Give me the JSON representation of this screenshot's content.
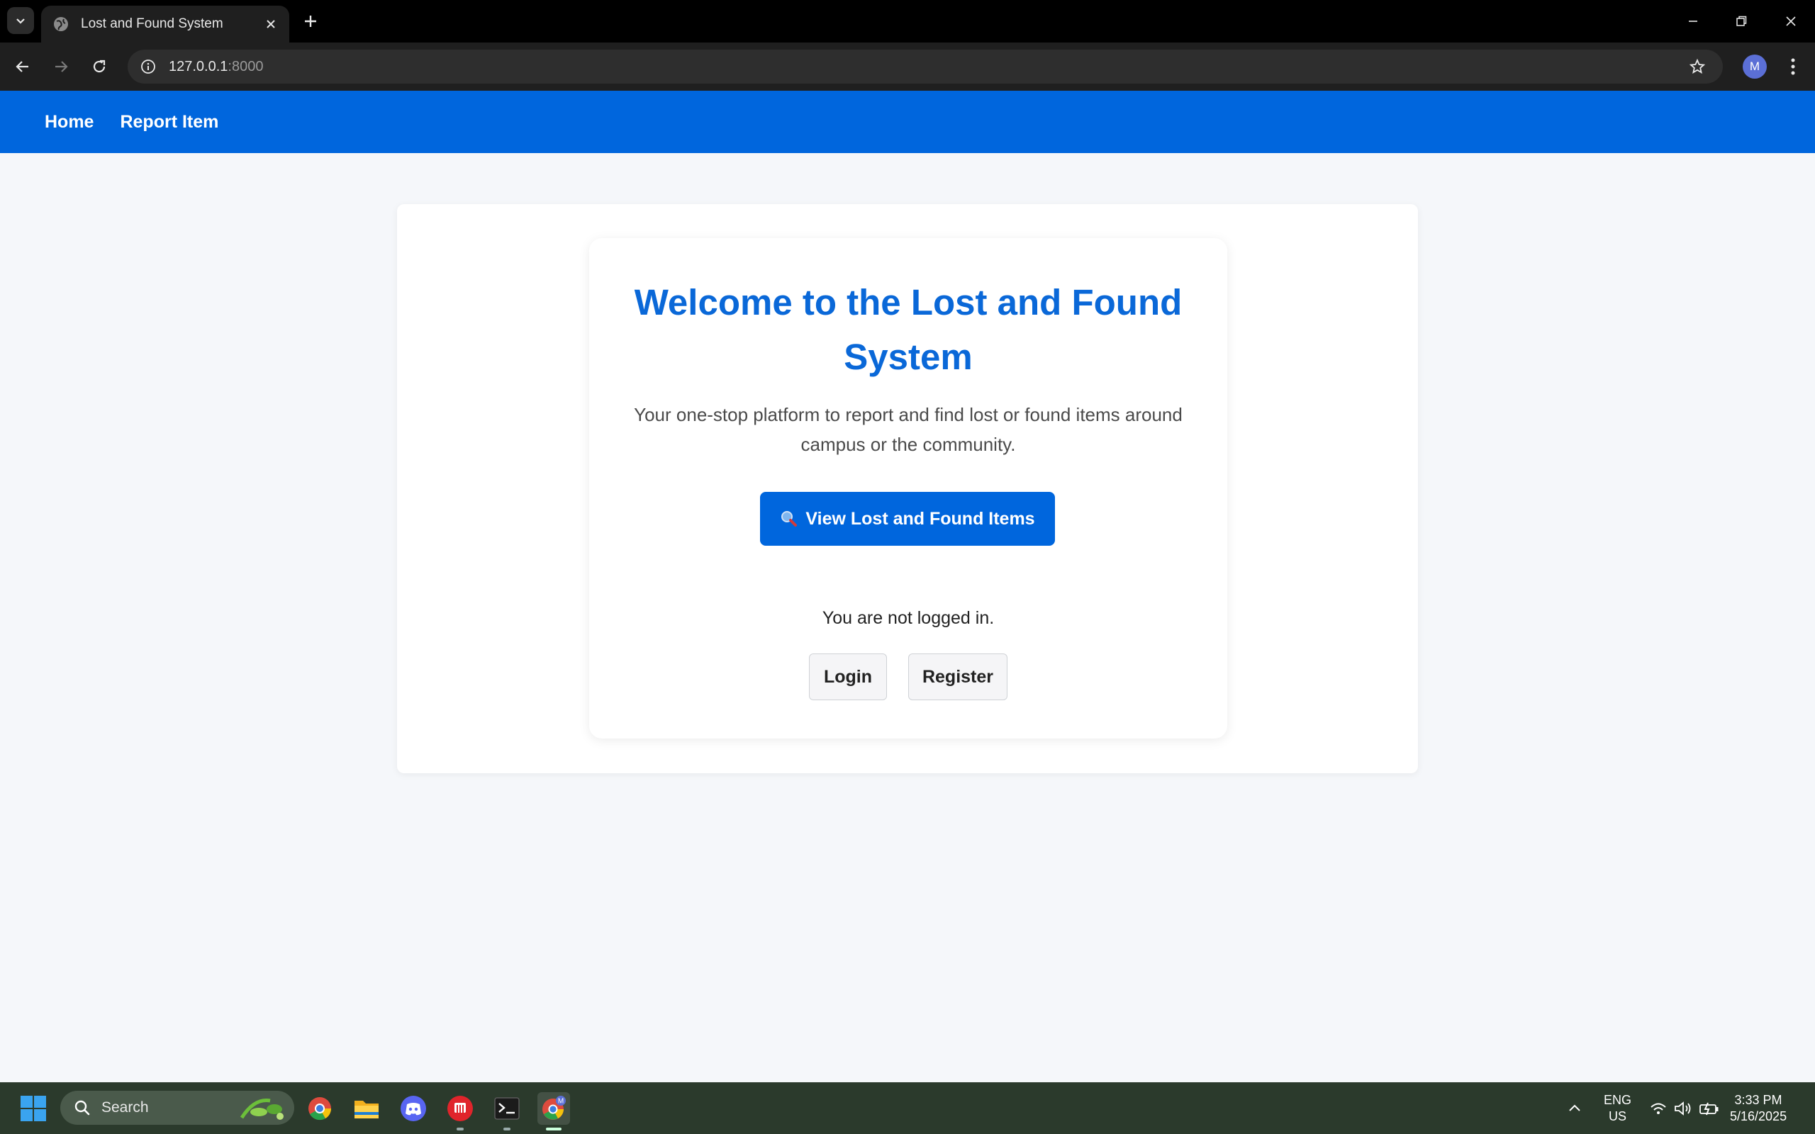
{
  "browser": {
    "tab_title": "Lost and Found System",
    "url_host": "127.0.0.1",
    "url_port": ":8000",
    "profile_initial": "M"
  },
  "nav": {
    "items": [
      {
        "label": "Home"
      },
      {
        "label": "Report Item"
      }
    ]
  },
  "hero": {
    "title": "Welcome to the Lost and Found System",
    "subtitle": "Your one-stop platform to report and find lost or found items around campus or the community.",
    "view_button": "View Lost and Found Items"
  },
  "auth": {
    "status": "You are not logged in.",
    "login_label": "Login",
    "register_label": "Register"
  },
  "taskbar": {
    "search_placeholder": "Search",
    "language": "ENG",
    "region": "US",
    "time": "3:33 PM",
    "date": "5/16/2025",
    "chrome_badge": "M"
  },
  "colors": {
    "brand": "#0066dd",
    "title": "#0a68d8",
    "page_bg": "#f5f7fa"
  }
}
